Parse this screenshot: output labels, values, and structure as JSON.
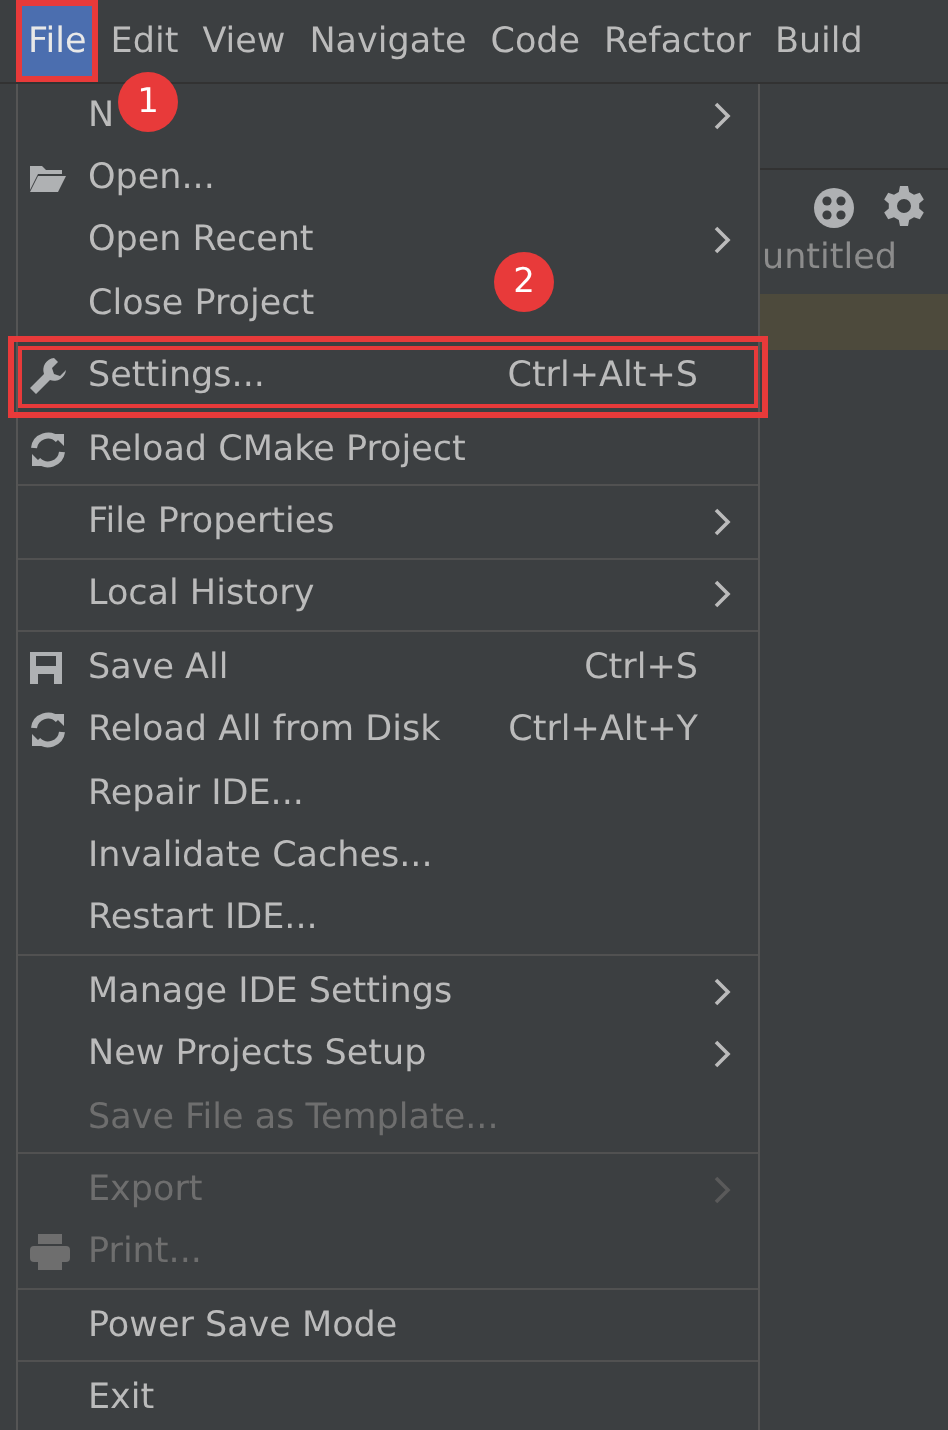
{
  "menubar": [
    {
      "label": "File",
      "selected": true,
      "annotated": true
    },
    {
      "label": "Edit",
      "selected": false,
      "annotated": false
    },
    {
      "label": "View",
      "selected": false,
      "annotated": false
    },
    {
      "label": "Navigate",
      "selected": false,
      "annotated": false
    },
    {
      "label": "Code",
      "selected": false,
      "annotated": false
    },
    {
      "label": "Refactor",
      "selected": false,
      "annotated": false
    },
    {
      "label": "Build",
      "selected": false,
      "annotated": false
    }
  ],
  "file_menu": [
    {
      "kind": "item",
      "label": "N",
      "submenu": true,
      "disabled": false,
      "annotated": false
    },
    {
      "kind": "item",
      "label": "Open...",
      "submenu": false,
      "disabled": false,
      "annotated": false
    },
    {
      "kind": "item",
      "label": "Open Recent",
      "submenu": true,
      "disabled": false,
      "annotated": false
    },
    {
      "kind": "item",
      "label": "Close Project",
      "submenu": false,
      "disabled": false,
      "annotated": false
    },
    {
      "kind": "separator"
    },
    {
      "kind": "item",
      "label": "Settings...",
      "shortcut": "Ctrl+Alt+S",
      "submenu": false,
      "disabled": false,
      "annotated": true
    },
    {
      "kind": "separator"
    },
    {
      "kind": "item",
      "label": "Reload CMake Project",
      "submenu": false,
      "disabled": false,
      "annotated": false
    },
    {
      "kind": "separator"
    },
    {
      "kind": "item",
      "label": "File Properties",
      "submenu": true,
      "disabled": false,
      "annotated": false
    },
    {
      "kind": "separator"
    },
    {
      "kind": "item",
      "label": "Local History",
      "submenu": true,
      "disabled": false,
      "annotated": false
    },
    {
      "kind": "separator"
    },
    {
      "kind": "item",
      "label": "Save All",
      "shortcut": "Ctrl+S",
      "submenu": false,
      "disabled": false,
      "annotated": false
    },
    {
      "kind": "item",
      "label": "Reload All from Disk",
      "shortcut": "Ctrl+Alt+Y",
      "submenu": false,
      "disabled": false,
      "annotated": false
    },
    {
      "kind": "item",
      "label": "Repair IDE...",
      "submenu": false,
      "disabled": false,
      "annotated": false
    },
    {
      "kind": "item",
      "label": "Invalidate Caches...",
      "submenu": false,
      "disabled": false,
      "annotated": false
    },
    {
      "kind": "item",
      "label": "Restart IDE...",
      "submenu": false,
      "disabled": false,
      "annotated": false
    },
    {
      "kind": "separator"
    },
    {
      "kind": "item",
      "label": "Manage IDE Settings",
      "submenu": true,
      "disabled": false,
      "annotated": false
    },
    {
      "kind": "item",
      "label": "New Projects Setup",
      "submenu": true,
      "disabled": false,
      "annotated": false
    },
    {
      "kind": "item",
      "label": "Save File as Template...",
      "submenu": false,
      "disabled": true,
      "annotated": false
    },
    {
      "kind": "separator"
    },
    {
      "kind": "item",
      "label": "Export",
      "submenu": true,
      "disabled": true,
      "annotated": false
    },
    {
      "kind": "item",
      "label": "Print...",
      "submenu": false,
      "disabled": true,
      "annotated": false
    },
    {
      "kind": "separator"
    },
    {
      "kind": "item",
      "label": "Power Save Mode",
      "submenu": false,
      "disabled": false,
      "annotated": false
    },
    {
      "kind": "separator"
    },
    {
      "kind": "item",
      "label": "Exit",
      "submenu": false,
      "disabled": false,
      "annotated": false
    }
  ],
  "project_panel": {
    "title": "untitled"
  },
  "annotations": [
    {
      "label": "1"
    },
    {
      "label": "2"
    }
  ]
}
